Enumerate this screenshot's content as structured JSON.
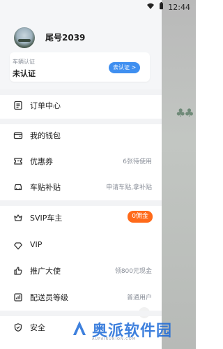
{
  "status_bar": {
    "time": "12:44"
  },
  "profile": {
    "username": "尾号2039",
    "certification": {
      "title": "车辆认证",
      "status": "未认证",
      "action": "去认证"
    }
  },
  "menu": {
    "orders": {
      "label": "订单中心",
      "icon": "document-icon"
    },
    "wallet": {
      "label": "我的钱包",
      "icon": "wallet-icon"
    },
    "coupons": {
      "label": "优惠券",
      "icon": "ticket-icon",
      "value": "6张待使用"
    },
    "car_sticker": {
      "label": "车贴补贴",
      "icon": "car-icon",
      "value": "申请车贴,拿补贴"
    },
    "svip": {
      "label": "SVIP车主",
      "icon": "crown-icon",
      "badge": "0佣金",
      "badge_color": "#ff6a1a"
    },
    "vip": {
      "label": "VIP",
      "icon": "diamond-icon"
    },
    "promoter": {
      "label": "推广大使",
      "icon": "thumb-up-icon",
      "value": "领800元现金"
    },
    "courier_level": {
      "label": "配送员等级",
      "icon": "level-icon",
      "value": "普通用户"
    },
    "security": {
      "label": "安全",
      "icon": "shield-icon"
    }
  },
  "watermark": {
    "brand": "奥派软件园",
    "sub": "AUPAIRUNION.COM"
  },
  "colors": {
    "accent": "#3f8ff0",
    "badge": "#ff6a1a"
  }
}
